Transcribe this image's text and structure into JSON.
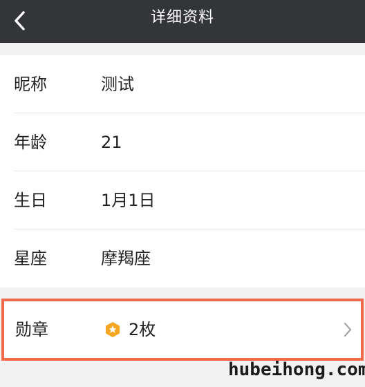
{
  "header": {
    "title": "详细资料",
    "back_icon": "chevron-left-icon"
  },
  "profile": {
    "nickname": {
      "label": "昵称",
      "value": "测试"
    },
    "age": {
      "label": "年龄",
      "value": "21"
    },
    "birthday": {
      "label": "生日",
      "value": "1月1日"
    },
    "zodiac": {
      "label": "星座",
      "value": "摩羯座"
    }
  },
  "medals": {
    "label": "勋章",
    "count": "2枚",
    "icon": "medal-icon",
    "highlight_color": "#f2694a",
    "medal_color": "#f5a623"
  },
  "watermark": "hubeihong.com",
  "colors": {
    "header_bg": "#333539",
    "page_bg": "#f2f2f2"
  }
}
